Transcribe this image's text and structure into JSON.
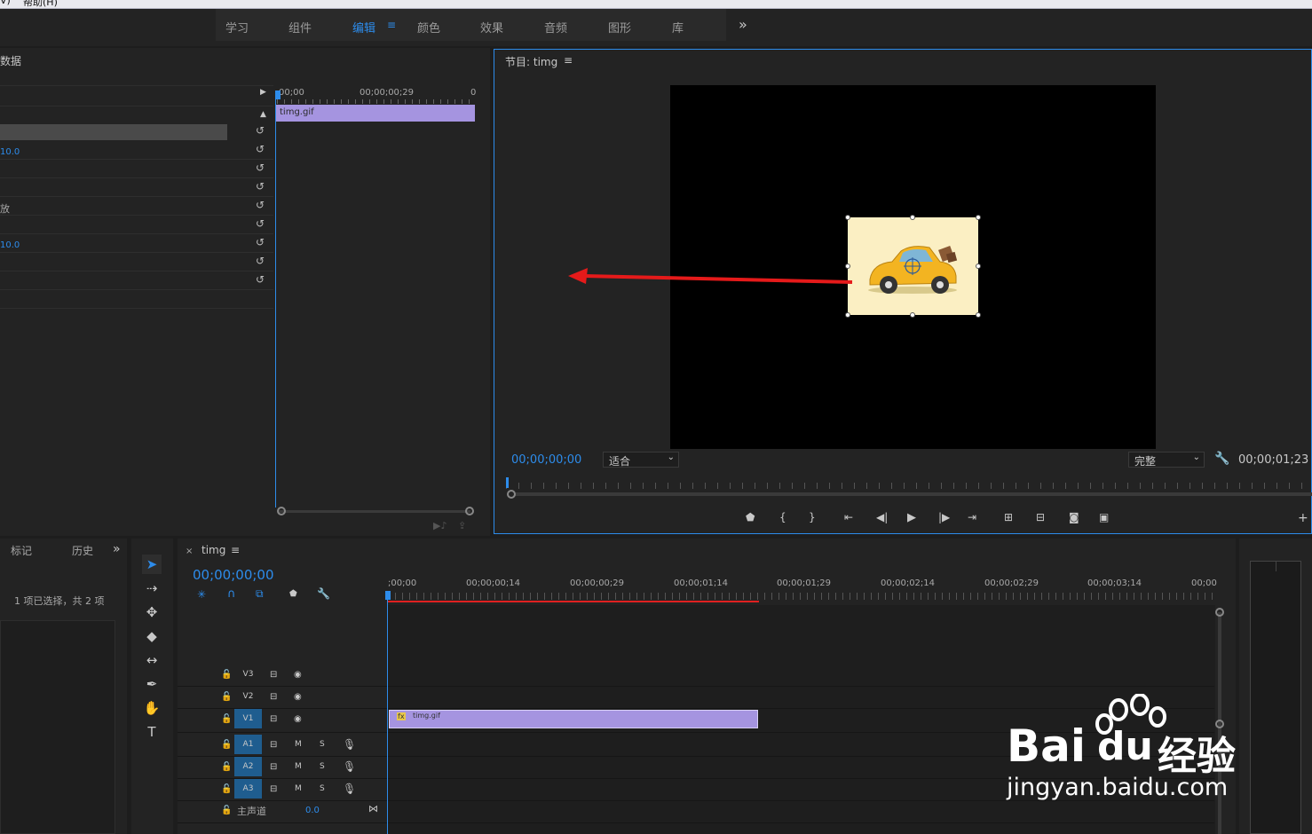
{
  "menubar": {
    "left_fragment": "V)",
    "help": "帮助(H)"
  },
  "workspaces": {
    "tabs": [
      "学习",
      "组件",
      "编辑",
      "颜色",
      "效果",
      "音频",
      "图形",
      "库"
    ],
    "active": "编辑",
    "more": "»"
  },
  "effect_controls": {
    "title_fragment": "数据",
    "ruler_start": "00;00",
    "ruler_mid": "00;00;00;29",
    "ruler_end": "0",
    "clip_name": "timg.gif",
    "value_1": "10.0",
    "label_scale": "放",
    "value_2": "10.0"
  },
  "program_monitor": {
    "title": "节目: timg",
    "timecode": "00;00;00;00",
    "fit": "适合",
    "quality": "完整",
    "duration": "00;00;01;23"
  },
  "project_panel": {
    "tab_markers": "标记",
    "tab_history": "历史",
    "selection_info": "1 项已选择，共 2 项"
  },
  "timeline": {
    "sequence_name": "timg",
    "timecode": "00;00;00;00",
    "ruler": [
      ";00;00",
      "00;00;00;14",
      "00;00;00;29",
      "00;00;01;14",
      "00;00;01;29",
      "00;00;02;14",
      "00;00;02;29",
      "00;00;03;14",
      "00;00"
    ],
    "video_tracks": [
      "V3",
      "V2",
      "V1"
    ],
    "audio_tracks": [
      "A1",
      "A2",
      "A3"
    ],
    "mute_label": "M",
    "solo_label": "S",
    "master_label": "主声道",
    "master_value": "0.0",
    "clip_name": "timg.gif",
    "fx_badge": "fx"
  },
  "watermark": {
    "brand": "Bai",
    "brand_suffix": "du",
    "cn": "经验",
    "url": "jingyan.baidu.com"
  },
  "colors": {
    "accent": "#2d8ceb",
    "clip": "#a594e0",
    "track_on": "#1f5d8f",
    "arrow": "#e51a1a"
  }
}
